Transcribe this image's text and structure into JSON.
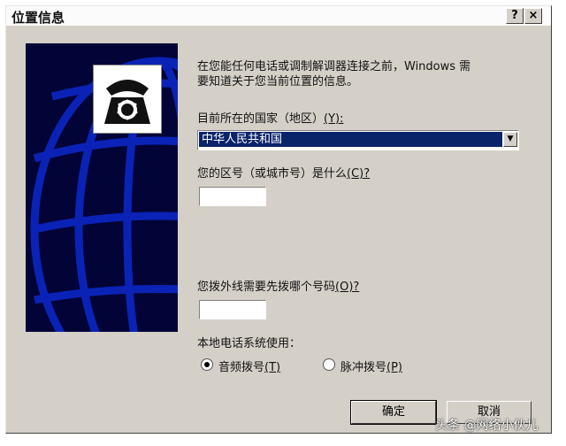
{
  "window": {
    "title": "位置信息",
    "help_button": "?",
    "close_button": "×"
  },
  "intro": {
    "line1": "在您能任何电话或调制解调器连接之前，Windows 需",
    "line2": "要知道关于您当前位置的信息。"
  },
  "country": {
    "label": "目前所在的国家（地区）",
    "hotkey": "(Y):",
    "selected": "中华人民共和国"
  },
  "area_code": {
    "label": "您的区号（或城市号）是什么",
    "hotkey": "(C)?",
    "value": ""
  },
  "outside_line": {
    "label": "您拨外线需要先拨哪个号码",
    "hotkey": "(O)?",
    "value": ""
  },
  "dial_type": {
    "label": "本地电话系统使用：",
    "options": [
      {
        "label": "音频拨号",
        "hotkey": "(T)",
        "selected": true
      },
      {
        "label": "脉冲拨号",
        "hotkey": "(P)",
        "selected": false
      }
    ]
  },
  "buttons": {
    "ok": "确定",
    "cancel": "取消"
  },
  "watermark": "头条 @网络小伙儿",
  "colors": {
    "art_background": "#020437",
    "globe_lines": "#0a23b6",
    "selection": "#0a246a"
  }
}
